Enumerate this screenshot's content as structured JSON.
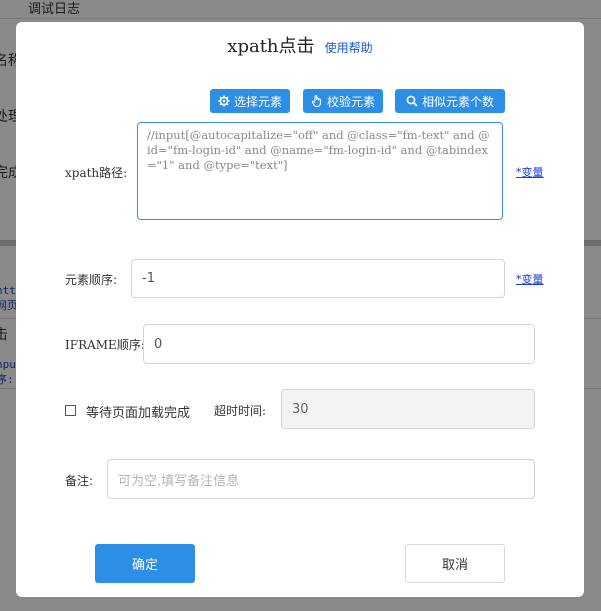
{
  "background": {
    "tab": "调试日志",
    "fragments": [
      "名称",
      "处理",
      "完成",
      "htt",
      "网页",
      "击",
      "npu",
      "序:"
    ]
  },
  "dialog": {
    "title": "xpath点击",
    "help_link": "使用帮助",
    "toolbar": {
      "select_element": "选择元素",
      "verify_element": "校验元素",
      "similar_count": "相似元素个数"
    },
    "xpath": {
      "label": "xpath路径:",
      "value": "//input[@autocapitalize=\"off\" and @class=\"fm-text\" and @id=\"fm-login-id\" and @name=\"fm-login-id\" and @tabindex=\"1\" and @type=\"text\"]",
      "var_link": "*变量"
    },
    "element_order": {
      "label": "元素顺序:",
      "value": "-1",
      "var_link": "*变量"
    },
    "iframe_order": {
      "label": "IFRAME顺序:",
      "value": "0"
    },
    "wait_page": {
      "label": "等待页面加载完成",
      "checked": false
    },
    "timeout": {
      "label": "超时时间:",
      "value": "30"
    },
    "note": {
      "label": "备注:",
      "placeholder": "可为空,填写备注信息"
    },
    "buttons": {
      "confirm": "确定",
      "cancel": "取消"
    }
  },
  "colors": {
    "primary": "#2d8ee6",
    "link": "#1a56d6",
    "focus_border": "#3d8fe0"
  }
}
